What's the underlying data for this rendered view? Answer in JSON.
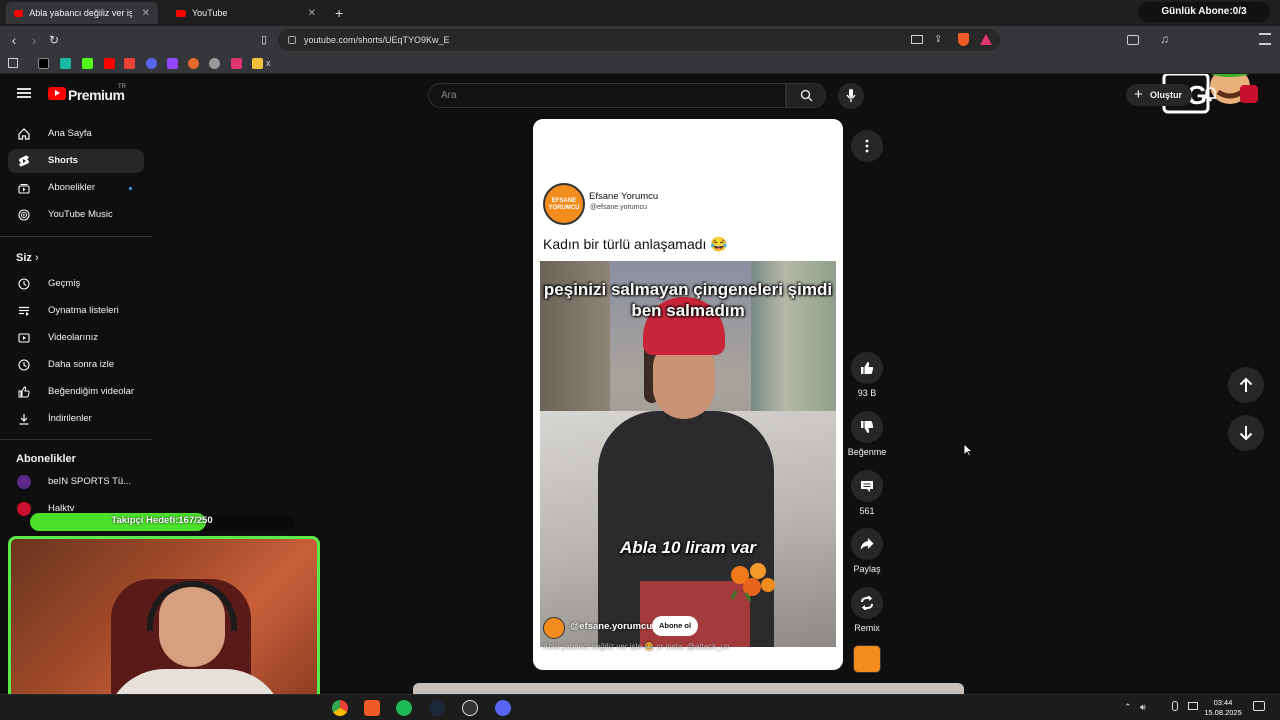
{
  "browser": {
    "tabs": [
      {
        "label": "Abla yabancı değiliz ver işte 😂",
        "active": true
      },
      {
        "label": "YouTube",
        "active": false
      }
    ],
    "url": "youtube.com/shorts/UEqTYO9Kw_E",
    "bookmark_folder_label": "x"
  },
  "overlay": {
    "daily_sub_label": "Günlük Abone:0/3",
    "follower_goal_label": "Takipçi Hedefi:167/250",
    "follower_progress": 0.668
  },
  "youtube": {
    "brand": "Premium",
    "region": "TR",
    "search_placeholder": "Ara",
    "create_label": "Oluştur",
    "sidebar": {
      "main": [
        {
          "label": "Ana Sayfa",
          "icon": "home-icon"
        },
        {
          "label": "Shorts",
          "icon": "shorts-icon",
          "active": true
        },
        {
          "label": "Abonelikler",
          "icon": "subscriptions-icon",
          "has_new": true
        },
        {
          "label": "YouTube Music",
          "icon": "music-icon"
        }
      ],
      "you_header": "Siz",
      "you": [
        {
          "label": "Geçmiş",
          "icon": "history-icon"
        },
        {
          "label": "Oynatma listeleri",
          "icon": "playlist-icon"
        },
        {
          "label": "Videolarınız",
          "icon": "your-videos-icon"
        },
        {
          "label": "Daha sonra izle",
          "icon": "watch-later-icon"
        },
        {
          "label": "Beğendiğim videolar",
          "icon": "liked-icon"
        },
        {
          "label": "İndirilenler",
          "icon": "download-icon"
        }
      ],
      "subs_header": "Abonelikler",
      "subs": [
        {
          "label": "beIN SPORTS Tü...",
          "color": "#5b2a86"
        },
        {
          "label": "Halktv",
          "color": "#c8102e"
        }
      ]
    },
    "short": {
      "card_channel_name": "Efsane Yorumcu",
      "card_channel_handle": "@efsane.yorumcu",
      "channel_logo_text": "EFSANE YORUMCU",
      "caption": "Kadın bir türlü anlaşamadı 😂",
      "overlay_text": "peşinizi salmayan çingeneleri şimdi ben salmadım",
      "overlay_subtitle": "Abla 10 liram var",
      "video_channel": "@efsane.yorumcu",
      "subscribe_label": "Abone ol",
      "description": "Abla yabancı değiliz ver işte 😂 cr insta: @attack_un"
    },
    "actions": {
      "likes": "93 B",
      "dislike_label": "Beğenme",
      "comments": "561",
      "share_label": "Paylaş",
      "remix_label": "Remix"
    }
  },
  "taskbar": {
    "time": "03:44",
    "date": "15.08.2025"
  },
  "colors": {
    "yt_red": "#ff0000",
    "overlay_green": "#4be12a",
    "channel_orange": "#f28c1c"
  }
}
